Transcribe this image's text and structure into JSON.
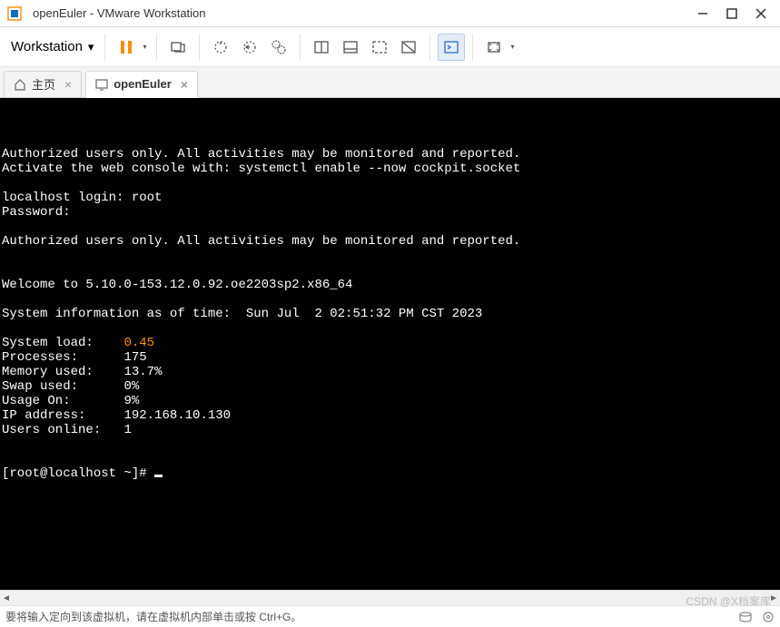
{
  "window": {
    "title": "openEuler - VMware Workstation"
  },
  "menu": {
    "workstation": "Workstation"
  },
  "tabs": {
    "home": "主页",
    "active": "openEuler"
  },
  "terminal": {
    "auth1": "Authorized users only. All activities may be monitored and reported.",
    "activate": "Activate the web console with: systemctl enable --now cockpit.socket",
    "login": "localhost login: root",
    "password": "Password:",
    "auth2": "Authorized users only. All activities may be monitored and reported.",
    "welcome": "Welcome to 5.10.0-153.12.0.92.oe2203sp2.x86_64",
    "sysinfo_time": "System information as of time:  Sun Jul  2 02:51:32 PM CST 2023",
    "stats": {
      "system_load_label": "System load:",
      "system_load_value": "0.45",
      "processes_label": "Processes:",
      "processes_value": "175",
      "mem_label": "Memory used:",
      "mem_value": "13.7%",
      "swap_label": "Swap used:",
      "swap_value": "0%",
      "usage_label": "Usage On:",
      "usage_value": "9%",
      "ip_label": "IP address:",
      "ip_value": "192.168.10.130",
      "users_label": "Users online:",
      "users_value": "1"
    },
    "prompt": "[root@localhost ~]# "
  },
  "status": {
    "message": "要将输入定向到该虚拟机，请在虚拟机内部单击或按 Ctrl+G。"
  },
  "watermark": "CSDN @X档案库"
}
